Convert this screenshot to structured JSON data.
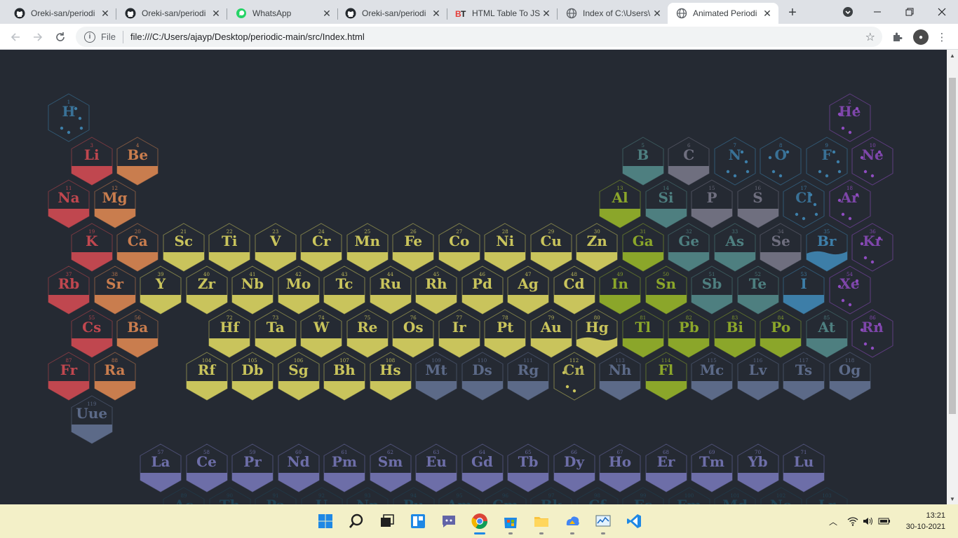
{
  "browser": {
    "tabs": [
      {
        "title": "Oreki-san/periodi",
        "icon": "github-icon",
        "active": false
      },
      {
        "title": "Oreki-san/periodi",
        "icon": "github-icon",
        "active": false
      },
      {
        "title": "WhatsApp",
        "icon": "whatsapp-icon",
        "active": false
      },
      {
        "title": "Oreki-san/periodi",
        "icon": "github-icon",
        "active": false
      },
      {
        "title": "HTML Table To JS",
        "icon": "bt-icon",
        "active": false
      },
      {
        "title": "Index of C:\\Users\\",
        "icon": "globe-icon",
        "active": false
      },
      {
        "title": "Animated Periodi",
        "icon": "globe-icon",
        "active": true
      }
    ],
    "address": {
      "scheme": "File",
      "url": "file:///C:/Users/ajayp/Desktop/periodic-main/src/Index.html"
    }
  },
  "colors": {
    "background": "#252a33",
    "alkali": "#c0474f",
    "alkaline": "#c97d4e",
    "transition": "#c9c45c",
    "post_transition": "#8ba62a",
    "metalloid": "#4e7f80",
    "nonmetal": "#6f6f7f",
    "halogen": "#3d7ea8",
    "noble": "#8e4cbf",
    "lanthanide": "#6d6ea8",
    "actinide": "#1f5a73",
    "unknown": "#5c6a88",
    "dim_nonmetal": "#2a6178"
  },
  "elements": [
    {
      "n": 1,
      "s": "H",
      "r": 0,
      "c": 0,
      "cat": "halogen",
      "style": "gas"
    },
    {
      "n": 2,
      "s": "He",
      "r": 0,
      "c": 17,
      "cat": "noble",
      "style": "gas"
    },
    {
      "n": 3,
      "s": "Li",
      "r": 1,
      "c": 0,
      "cat": "alkali",
      "style": "solid"
    },
    {
      "n": 4,
      "s": "Be",
      "r": 1,
      "c": 1,
      "cat": "alkaline",
      "style": "solid"
    },
    {
      "n": 5,
      "s": "B",
      "r": 1,
      "c": 12,
      "cat": "metalloid",
      "style": "solid"
    },
    {
      "n": 6,
      "s": "C",
      "r": 1,
      "c": 13,
      "cat": "nonmetal",
      "style": "solid"
    },
    {
      "n": 7,
      "s": "N",
      "r": 1,
      "c": 14,
      "cat": "halogen",
      "style": "gas"
    },
    {
      "n": 8,
      "s": "O",
      "r": 1,
      "c": 15,
      "cat": "halogen",
      "style": "gas"
    },
    {
      "n": 9,
      "s": "F",
      "r": 1,
      "c": 16,
      "cat": "halogen",
      "style": "gas"
    },
    {
      "n": 10,
      "s": "Ne",
      "r": 1,
      "c": 17,
      "cat": "noble",
      "style": "gas"
    },
    {
      "n": 11,
      "s": "Na",
      "r": 2,
      "c": 0,
      "cat": "alkali",
      "style": "solid"
    },
    {
      "n": 12,
      "s": "Mg",
      "r": 2,
      "c": 1,
      "cat": "alkaline",
      "style": "solid"
    },
    {
      "n": 13,
      "s": "Al",
      "r": 2,
      "c": 12,
      "cat": "post_transition",
      "style": "solid"
    },
    {
      "n": 14,
      "s": "Si",
      "r": 2,
      "c": 13,
      "cat": "metalloid",
      "style": "solid"
    },
    {
      "n": 15,
      "s": "P",
      "r": 2,
      "c": 14,
      "cat": "nonmetal",
      "style": "solid"
    },
    {
      "n": 16,
      "s": "S",
      "r": 2,
      "c": 15,
      "cat": "nonmetal",
      "style": "solid"
    },
    {
      "n": 17,
      "s": "Cl",
      "r": 2,
      "c": 16,
      "cat": "halogen",
      "style": "gas"
    },
    {
      "n": 18,
      "s": "Ar",
      "r": 2,
      "c": 17,
      "cat": "noble",
      "style": "gas"
    },
    {
      "n": 19,
      "s": "K",
      "r": 3,
      "c": 0,
      "cat": "alkali",
      "style": "solid"
    },
    {
      "n": 20,
      "s": "Ca",
      "r": 3,
      "c": 1,
      "cat": "alkaline",
      "style": "solid"
    },
    {
      "n": 21,
      "s": "Sc",
      "r": 3,
      "c": 2,
      "cat": "transition",
      "style": "solid"
    },
    {
      "n": 22,
      "s": "Ti",
      "r": 3,
      "c": 3,
      "cat": "transition",
      "style": "solid"
    },
    {
      "n": 23,
      "s": "V",
      "r": 3,
      "c": 4,
      "cat": "transition",
      "style": "solid"
    },
    {
      "n": 24,
      "s": "Cr",
      "r": 3,
      "c": 5,
      "cat": "transition",
      "style": "solid"
    },
    {
      "n": 25,
      "s": "Mn",
      "r": 3,
      "c": 6,
      "cat": "transition",
      "style": "solid"
    },
    {
      "n": 26,
      "s": "Fe",
      "r": 3,
      "c": 7,
      "cat": "transition",
      "style": "solid"
    },
    {
      "n": 27,
      "s": "Co",
      "r": 3,
      "c": 8,
      "cat": "transition",
      "style": "solid"
    },
    {
      "n": 28,
      "s": "Ni",
      "r": 3,
      "c": 9,
      "cat": "transition",
      "style": "solid"
    },
    {
      "n": 29,
      "s": "Cu",
      "r": 3,
      "c": 10,
      "cat": "transition",
      "style": "solid"
    },
    {
      "n": 30,
      "s": "Zn",
      "r": 3,
      "c": 11,
      "cat": "transition",
      "style": "solid"
    },
    {
      "n": 31,
      "s": "Ga",
      "r": 3,
      "c": 12,
      "cat": "post_transition",
      "style": "solid"
    },
    {
      "n": 32,
      "s": "Ge",
      "r": 3,
      "c": 13,
      "cat": "metalloid",
      "style": "solid"
    },
    {
      "n": 33,
      "s": "As",
      "r": 3,
      "c": 14,
      "cat": "metalloid",
      "style": "solid"
    },
    {
      "n": 34,
      "s": "Se",
      "r": 3,
      "c": 15,
      "cat": "nonmetal",
      "style": "solid"
    },
    {
      "n": 35,
      "s": "Br",
      "r": 3,
      "c": 16,
      "cat": "halogen",
      "style": "liquid"
    },
    {
      "n": 36,
      "s": "Kr",
      "r": 3,
      "c": 17,
      "cat": "noble",
      "style": "gas"
    },
    {
      "n": 37,
      "s": "Rb",
      "r": 4,
      "c": 0,
      "cat": "alkali",
      "style": "solid"
    },
    {
      "n": 38,
      "s": "Sr",
      "r": 4,
      "c": 1,
      "cat": "alkaline",
      "style": "solid"
    },
    {
      "n": 39,
      "s": "Y",
      "r": 4,
      "c": 2,
      "cat": "transition",
      "style": "solid"
    },
    {
      "n": 40,
      "s": "Zr",
      "r": 4,
      "c": 3,
      "cat": "transition",
      "style": "solid"
    },
    {
      "n": 41,
      "s": "Nb",
      "r": 4,
      "c": 4,
      "cat": "transition",
      "style": "solid"
    },
    {
      "n": 42,
      "s": "Mo",
      "r": 4,
      "c": 5,
      "cat": "transition",
      "style": "solid"
    },
    {
      "n": 43,
      "s": "Tc",
      "r": 4,
      "c": 6,
      "cat": "transition",
      "style": "solid"
    },
    {
      "n": 44,
      "s": "Ru",
      "r": 4,
      "c": 7,
      "cat": "transition",
      "style": "solid"
    },
    {
      "n": 45,
      "s": "Rh",
      "r": 4,
      "c": 8,
      "cat": "transition",
      "style": "solid"
    },
    {
      "n": 46,
      "s": "Pd",
      "r": 4,
      "c": 9,
      "cat": "transition",
      "style": "solid"
    },
    {
      "n": 47,
      "s": "Ag",
      "r": 4,
      "c": 10,
      "cat": "transition",
      "style": "solid"
    },
    {
      "n": 48,
      "s": "Cd",
      "r": 4,
      "c": 11,
      "cat": "transition",
      "style": "solid"
    },
    {
      "n": 49,
      "s": "In",
      "r": 4,
      "c": 12,
      "cat": "post_transition",
      "style": "solid"
    },
    {
      "n": 50,
      "s": "Sn",
      "r": 4,
      "c": 13,
      "cat": "post_transition",
      "style": "solid"
    },
    {
      "n": 51,
      "s": "Sb",
      "r": 4,
      "c": 14,
      "cat": "metalloid",
      "style": "solid"
    },
    {
      "n": 52,
      "s": "Te",
      "r": 4,
      "c": 15,
      "cat": "metalloid",
      "style": "solid"
    },
    {
      "n": 53,
      "s": "I",
      "r": 4,
      "c": 16,
      "cat": "halogen",
      "style": "solid"
    },
    {
      "n": 54,
      "s": "Xe",
      "r": 4,
      "c": 17,
      "cat": "noble",
      "style": "gas"
    },
    {
      "n": 55,
      "s": "Cs",
      "r": 5,
      "c": 0,
      "cat": "alkali",
      "style": "solid"
    },
    {
      "n": 56,
      "s": "Ba",
      "r": 5,
      "c": 1,
      "cat": "alkaline",
      "style": "solid"
    },
    {
      "n": 72,
      "s": "Hf",
      "r": 5,
      "c": 3,
      "cat": "transition",
      "style": "solid"
    },
    {
      "n": 73,
      "s": "Ta",
      "r": 5,
      "c": 4,
      "cat": "transition",
      "style": "solid"
    },
    {
      "n": 74,
      "s": "W",
      "r": 5,
      "c": 5,
      "cat": "transition",
      "style": "solid"
    },
    {
      "n": 75,
      "s": "Re",
      "r": 5,
      "c": 6,
      "cat": "transition",
      "style": "solid"
    },
    {
      "n": 76,
      "s": "Os",
      "r": 5,
      "c": 7,
      "cat": "transition",
      "style": "solid"
    },
    {
      "n": 77,
      "s": "Ir",
      "r": 5,
      "c": 8,
      "cat": "transition",
      "style": "solid"
    },
    {
      "n": 78,
      "s": "Pt",
      "r": 5,
      "c": 9,
      "cat": "transition",
      "style": "solid"
    },
    {
      "n": 79,
      "s": "Au",
      "r": 5,
      "c": 10,
      "cat": "transition",
      "style": "solid"
    },
    {
      "n": 80,
      "s": "Hg",
      "r": 5,
      "c": 11,
      "cat": "transition",
      "style": "liquid"
    },
    {
      "n": 81,
      "s": "Tl",
      "r": 5,
      "c": 12,
      "cat": "post_transition",
      "style": "solid"
    },
    {
      "n": 82,
      "s": "Pb",
      "r": 5,
      "c": 13,
      "cat": "post_transition",
      "style": "solid"
    },
    {
      "n": 83,
      "s": "Bi",
      "r": 5,
      "c": 14,
      "cat": "post_transition",
      "style": "solid"
    },
    {
      "n": 84,
      "s": "Po",
      "r": 5,
      "c": 15,
      "cat": "post_transition",
      "style": "solid"
    },
    {
      "n": 85,
      "s": "At",
      "r": 5,
      "c": 16,
      "cat": "metalloid",
      "style": "solid"
    },
    {
      "n": 86,
      "s": "Rn",
      "r": 5,
      "c": 17,
      "cat": "noble",
      "style": "gas"
    },
    {
      "n": 87,
      "s": "Fr",
      "r": 6,
      "c": 0,
      "cat": "alkali",
      "style": "solid"
    },
    {
      "n": 88,
      "s": "Ra",
      "r": 6,
      "c": 1,
      "cat": "alkaline",
      "style": "solid"
    },
    {
      "n": 104,
      "s": "Rf",
      "r": 6,
      "c": 3,
      "cat": "transition",
      "style": "solid"
    },
    {
      "n": 105,
      "s": "Db",
      "r": 6,
      "c": 4,
      "cat": "transition",
      "style": "solid"
    },
    {
      "n": 106,
      "s": "Sg",
      "r": 6,
      "c": 5,
      "cat": "transition",
      "style": "solid"
    },
    {
      "n": 107,
      "s": "Bh",
      "r": 6,
      "c": 6,
      "cat": "transition",
      "style": "solid"
    },
    {
      "n": 108,
      "s": "Hs",
      "r": 6,
      "c": 7,
      "cat": "transition",
      "style": "solid"
    },
    {
      "n": 109,
      "s": "Mt",
      "r": 6,
      "c": 8,
      "cat": "unknown",
      "style": "solid"
    },
    {
      "n": 110,
      "s": "Ds",
      "r": 6,
      "c": 9,
      "cat": "unknown",
      "style": "solid"
    },
    {
      "n": 111,
      "s": "Rg",
      "r": 6,
      "c": 10,
      "cat": "unknown",
      "style": "solid"
    },
    {
      "n": 112,
      "s": "Cn",
      "r": 6,
      "c": 11,
      "cat": "transition",
      "style": "gas"
    },
    {
      "n": 113,
      "s": "Nh",
      "r": 6,
      "c": 12,
      "cat": "unknown",
      "style": "solid"
    },
    {
      "n": 114,
      "s": "Fl",
      "r": 6,
      "c": 13,
      "cat": "post_transition",
      "style": "solid"
    },
    {
      "n": 115,
      "s": "Mc",
      "r": 6,
      "c": 14,
      "cat": "unknown",
      "style": "solid"
    },
    {
      "n": 116,
      "s": "Lv",
      "r": 6,
      "c": 15,
      "cat": "unknown",
      "style": "solid"
    },
    {
      "n": 117,
      "s": "Ts",
      "r": 6,
      "c": 16,
      "cat": "unknown",
      "style": "solid"
    },
    {
      "n": 118,
      "s": "Og",
      "r": 6,
      "c": 17,
      "cat": "unknown",
      "style": "solid"
    },
    {
      "n": 119,
      "s": "Uue",
      "r": 7,
      "c": 0,
      "cat": "unknown",
      "style": "solid"
    },
    {
      "n": 57,
      "s": "La",
      "r": 8,
      "c": 2,
      "cat": "lanthanide",
      "style": "solid"
    },
    {
      "n": 58,
      "s": "Ce",
      "r": 8,
      "c": 3,
      "cat": "lanthanide",
      "style": "solid"
    },
    {
      "n": 59,
      "s": "Pr",
      "r": 8,
      "c": 4,
      "cat": "lanthanide",
      "style": "solid"
    },
    {
      "n": 60,
      "s": "Nd",
      "r": 8,
      "c": 5,
      "cat": "lanthanide",
      "style": "solid"
    },
    {
      "n": 61,
      "s": "Pm",
      "r": 8,
      "c": 6,
      "cat": "lanthanide",
      "style": "solid"
    },
    {
      "n": 62,
      "s": "Sm",
      "r": 8,
      "c": 7,
      "cat": "lanthanide",
      "style": "solid"
    },
    {
      "n": 63,
      "s": "Eu",
      "r": 8,
      "c": 8,
      "cat": "lanthanide",
      "style": "solid"
    },
    {
      "n": 64,
      "s": "Gd",
      "r": 8,
      "c": 9,
      "cat": "lanthanide",
      "style": "solid"
    },
    {
      "n": 65,
      "s": "Tb",
      "r": 8,
      "c": 10,
      "cat": "lanthanide",
      "style": "solid"
    },
    {
      "n": 66,
      "s": "Dy",
      "r": 8,
      "c": 11,
      "cat": "lanthanide",
      "style": "solid"
    },
    {
      "n": 67,
      "s": "Ho",
      "r": 8,
      "c": 12,
      "cat": "lanthanide",
      "style": "solid"
    },
    {
      "n": 68,
      "s": "Er",
      "r": 8,
      "c": 13,
      "cat": "lanthanide",
      "style": "solid"
    },
    {
      "n": 69,
      "s": "Tm",
      "r": 8,
      "c": 14,
      "cat": "lanthanide",
      "style": "solid"
    },
    {
      "n": 70,
      "s": "Yb",
      "r": 8,
      "c": 15,
      "cat": "lanthanide",
      "style": "solid"
    },
    {
      "n": 71,
      "s": "Lu",
      "r": 8,
      "c": 16,
      "cat": "lanthanide",
      "style": "solid"
    },
    {
      "n": 89,
      "s": "Ac",
      "r": 9,
      "c": 2,
      "cat": "actinide",
      "style": "solid"
    },
    {
      "n": 90,
      "s": "Th",
      "r": 9,
      "c": 3,
      "cat": "actinide",
      "style": "solid"
    },
    {
      "n": 91,
      "s": "Pa",
      "r": 9,
      "c": 4,
      "cat": "actinide",
      "style": "solid"
    },
    {
      "n": 92,
      "s": "U",
      "r": 9,
      "c": 5,
      "cat": "actinide",
      "style": "solid"
    },
    {
      "n": 93,
      "s": "Np",
      "r": 9,
      "c": 6,
      "cat": "actinide",
      "style": "solid"
    },
    {
      "n": 94,
      "s": "Pu",
      "r": 9,
      "c": 7,
      "cat": "actinide",
      "style": "solid"
    },
    {
      "n": 95,
      "s": "Am",
      "r": 9,
      "c": 8,
      "cat": "actinide",
      "style": "solid"
    },
    {
      "n": 96,
      "s": "Cm",
      "r": 9,
      "c": 9,
      "cat": "actinide",
      "style": "solid"
    },
    {
      "n": 97,
      "s": "Bk",
      "r": 9,
      "c": 10,
      "cat": "actinide",
      "style": "solid"
    },
    {
      "n": 98,
      "s": "Cf",
      "r": 9,
      "c": 11,
      "cat": "actinide",
      "style": "solid"
    },
    {
      "n": 99,
      "s": "Es",
      "r": 9,
      "c": 12,
      "cat": "actinide",
      "style": "solid"
    },
    {
      "n": 100,
      "s": "Fm",
      "r": 9,
      "c": 13,
      "cat": "actinide",
      "style": "solid"
    },
    {
      "n": 101,
      "s": "Md",
      "r": 9,
      "c": 14,
      "cat": "actinide",
      "style": "solid"
    },
    {
      "n": 102,
      "s": "No",
      "r": 9,
      "c": 15,
      "cat": "actinide",
      "style": "solid"
    },
    {
      "n": 103,
      "s": "Lr",
      "r": 9,
      "c": 16,
      "cat": "actinide",
      "style": "solid"
    }
  ],
  "taskbar": {
    "apps": [
      "windows-start-icon",
      "search-icon",
      "task-view-icon",
      "widgets-icon",
      "teams-chat-icon",
      "chrome-icon",
      "store-icon",
      "file-explorer-icon",
      "google-drive-icon",
      "performance-monitor-icon",
      "vscode-icon"
    ],
    "time": "13:21",
    "date": "30-10-2021"
  }
}
